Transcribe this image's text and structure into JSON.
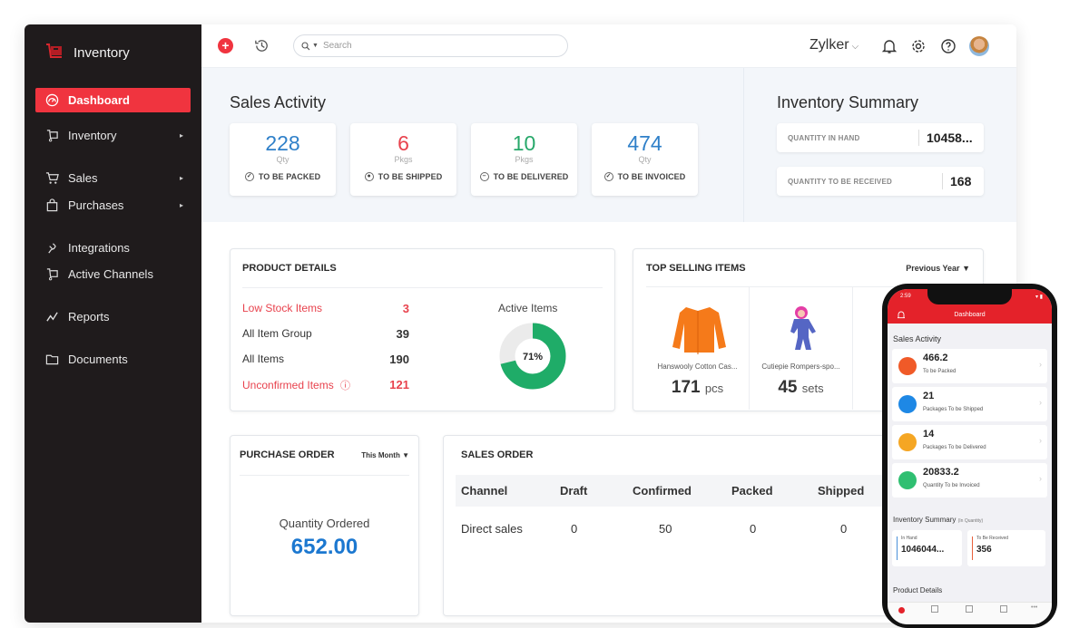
{
  "sidebar": {
    "brand": "Inventory",
    "items": [
      {
        "label": "Dashboard",
        "icon": "dashboard-icon",
        "active": true
      },
      {
        "label": "Inventory",
        "icon": "inventory-icon",
        "has_submenu": true
      },
      {
        "label": "Sales",
        "icon": "cart-icon",
        "has_submenu": true
      },
      {
        "label": "Purchases",
        "icon": "bag-icon",
        "has_submenu": true
      },
      {
        "label": "Integrations",
        "icon": "integrations-icon"
      },
      {
        "label": "Active Channels",
        "icon": "channels-icon"
      },
      {
        "label": "Reports",
        "icon": "reports-icon"
      },
      {
        "label": "Documents",
        "icon": "folder-icon"
      }
    ],
    "submenu_arrow": "▸"
  },
  "topbar": {
    "search_placeholder": "Search",
    "org_name": "Zylker",
    "org_chevron": "⌵"
  },
  "sales_activity": {
    "title": "Sales Activity",
    "cards": [
      {
        "value": "228",
        "unit": "Qty",
        "label": "TO BE PACKED",
        "color": "#2f80c9",
        "icon": "✓"
      },
      {
        "value": "6",
        "unit": "Pkgs",
        "label": "TO BE SHIPPED",
        "color": "#e8424d",
        "icon": "●"
      },
      {
        "value": "10",
        "unit": "Pkgs",
        "label": "TO BE DELIVERED",
        "color": "#27a86a",
        "icon": "–"
      },
      {
        "value": "474",
        "unit": "Qty",
        "label": "TO BE INVOICED",
        "color": "#2f80c9",
        "icon": "✓"
      }
    ]
  },
  "inventory_summary": {
    "title": "Inventory Summary",
    "rows": [
      {
        "label": "QUANTITY IN HAND",
        "value": "10458..."
      },
      {
        "label": "QUANTITY TO BE RECEIVED",
        "value": "168"
      }
    ]
  },
  "product_details": {
    "title": "PRODUCT DETAILS",
    "rows": [
      {
        "label": "Low Stock Items",
        "value": "3",
        "alert": true
      },
      {
        "label": "All Item Group",
        "value": "39"
      },
      {
        "label": "All Items",
        "value": "190"
      },
      {
        "label": "Unconfirmed Items",
        "value": "121",
        "alert": true,
        "info_icon": "ⓘ"
      }
    ],
    "active_items": {
      "label": "Active Items",
      "percent": 71,
      "percent_label": "71%"
    }
  },
  "top_selling": {
    "title": "TOP SELLING ITEMS",
    "period": "Previous Year",
    "items": [
      {
        "name": "Hanswooly Cotton Cas...",
        "qty": "171",
        "unit": "pcs"
      },
      {
        "name": "Cutiepie Rompers-spo...",
        "qty": "45",
        "unit": "sets"
      }
    ]
  },
  "purchase_order": {
    "title": "PURCHASE ORDER",
    "period": "This Month",
    "label": "Quantity Ordered",
    "value": "652.00"
  },
  "sales_order": {
    "title": "SALES ORDER",
    "columns": [
      "Channel",
      "Draft",
      "Confirmed",
      "Packed",
      "Shipped"
    ],
    "rows": [
      [
        "Direct sales",
        "0",
        "50",
        "0",
        "0"
      ]
    ]
  },
  "phone": {
    "time": "2:59",
    "title": "Dashboard",
    "sales_activity_title": "Sales Activity",
    "cards": [
      {
        "value": "466.2",
        "label": "To be Packed",
        "color": "#f05a28"
      },
      {
        "value": "21",
        "label": "Packages To be Shipped",
        "color": "#1e88e5"
      },
      {
        "value": "14",
        "label": "Packages To be Delivered",
        "color": "#f5a623"
      },
      {
        "value": "20833.2",
        "label": "Quantity To be Invoiced",
        "color": "#2fbf71"
      }
    ],
    "inventory_title": "Inventory Summary",
    "inventory_note": "(In Quantity)",
    "in_hand_label": "In Hand",
    "in_hand_value": "1046044...",
    "to_receive_label": "To Be Received",
    "to_receive_value": "356",
    "product_details_title": "Product Details"
  }
}
